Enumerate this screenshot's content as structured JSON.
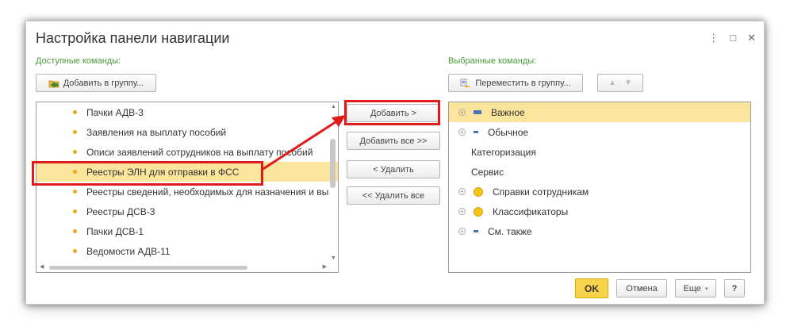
{
  "dialog": {
    "title": "Настройка панели навигации",
    "controls": {
      "menu": "⋮",
      "maximize": "□",
      "close": "✕"
    }
  },
  "left": {
    "label": "Доступные команды:",
    "add_to_group": "Добавить в группу...",
    "items": [
      "Пачки АДВ-3",
      "Заявления на выплату пособий",
      "Описи заявлений сотрудников на выплату пособий",
      "Реестры ЭЛН для отправки в ФСС",
      "Реестры сведений, необходимых для назначения и вы",
      "Реестры ДСВ-3",
      "Пачки ДСВ-1",
      "Ведомости АДВ-11"
    ],
    "selected_index": 3
  },
  "middle": {
    "add": "Добавить >",
    "add_all": "Добавить все >>",
    "remove": "< Удалить",
    "remove_all": "<< Удалить все"
  },
  "right": {
    "label": "Выбранные команды:",
    "move_to_group": "Переместить в группу...",
    "up_icon": "arrow-up-icon",
    "down_icon": "arrow-down-icon",
    "items": [
      {
        "text": "Важное",
        "icon": "blue-bar-icon",
        "expandable": true,
        "selected": true
      },
      {
        "text": "Обычное",
        "icon": "blue-small-bar-icon",
        "expandable": true
      },
      {
        "text": "Категоризация",
        "icon": "",
        "expandable": false
      },
      {
        "text": "Сервис",
        "icon": "",
        "expandable": false
      },
      {
        "text": "Справки сотрудникам",
        "icon": "yellow-circle-icon",
        "expandable": true
      },
      {
        "text": "Классификаторы",
        "icon": "yellow-circle-icon",
        "expandable": true
      },
      {
        "text": "См. также",
        "icon": "blue-small-bar-icon",
        "expandable": true
      }
    ]
  },
  "footer": {
    "ok": "OK",
    "cancel": "Отмена",
    "more": "Еще",
    "help": "?"
  },
  "colors": {
    "accent_yellow": "#f8d44a",
    "selection": "#fbe49b",
    "highlight_red": "#e01b1b",
    "label_green": "#4a9a3a"
  }
}
